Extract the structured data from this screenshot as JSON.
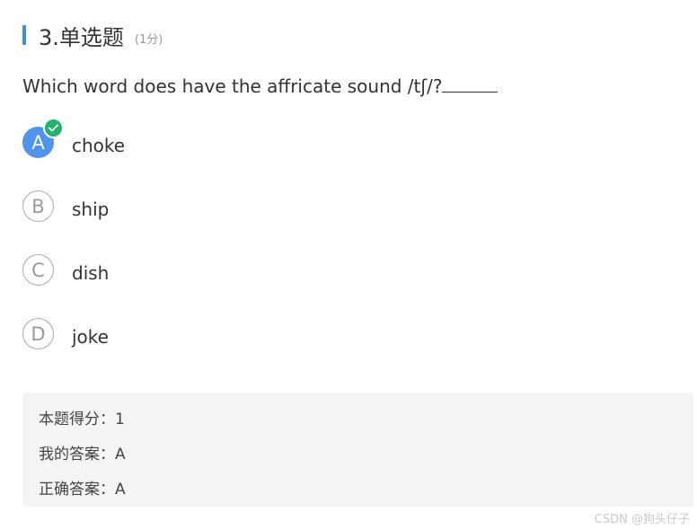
{
  "question": {
    "title": "3.单选题",
    "score": "(1分)",
    "stem": "Which word does have the affricate sound /tʃ/?"
  },
  "options": [
    {
      "letter": "A",
      "text": "choke",
      "selected": true
    },
    {
      "letter": "B",
      "text": "ship",
      "selected": false
    },
    {
      "letter": "C",
      "text": "dish",
      "selected": false
    },
    {
      "letter": "D",
      "text": "joke",
      "selected": false
    }
  ],
  "result": {
    "score_label": "本题得分",
    "score_value": "1",
    "my_answer_label": "我的答案",
    "my_answer_value": "A",
    "correct_answer_label": "正确答案",
    "correct_answer_value": "A"
  },
  "watermark": "CSDN @狗头仔子",
  "colors": {
    "accent": "#3a8ee6",
    "selected": "#4f95f0",
    "correct_check": "#22b36b",
    "panel_bg": "#f4f4f4"
  }
}
